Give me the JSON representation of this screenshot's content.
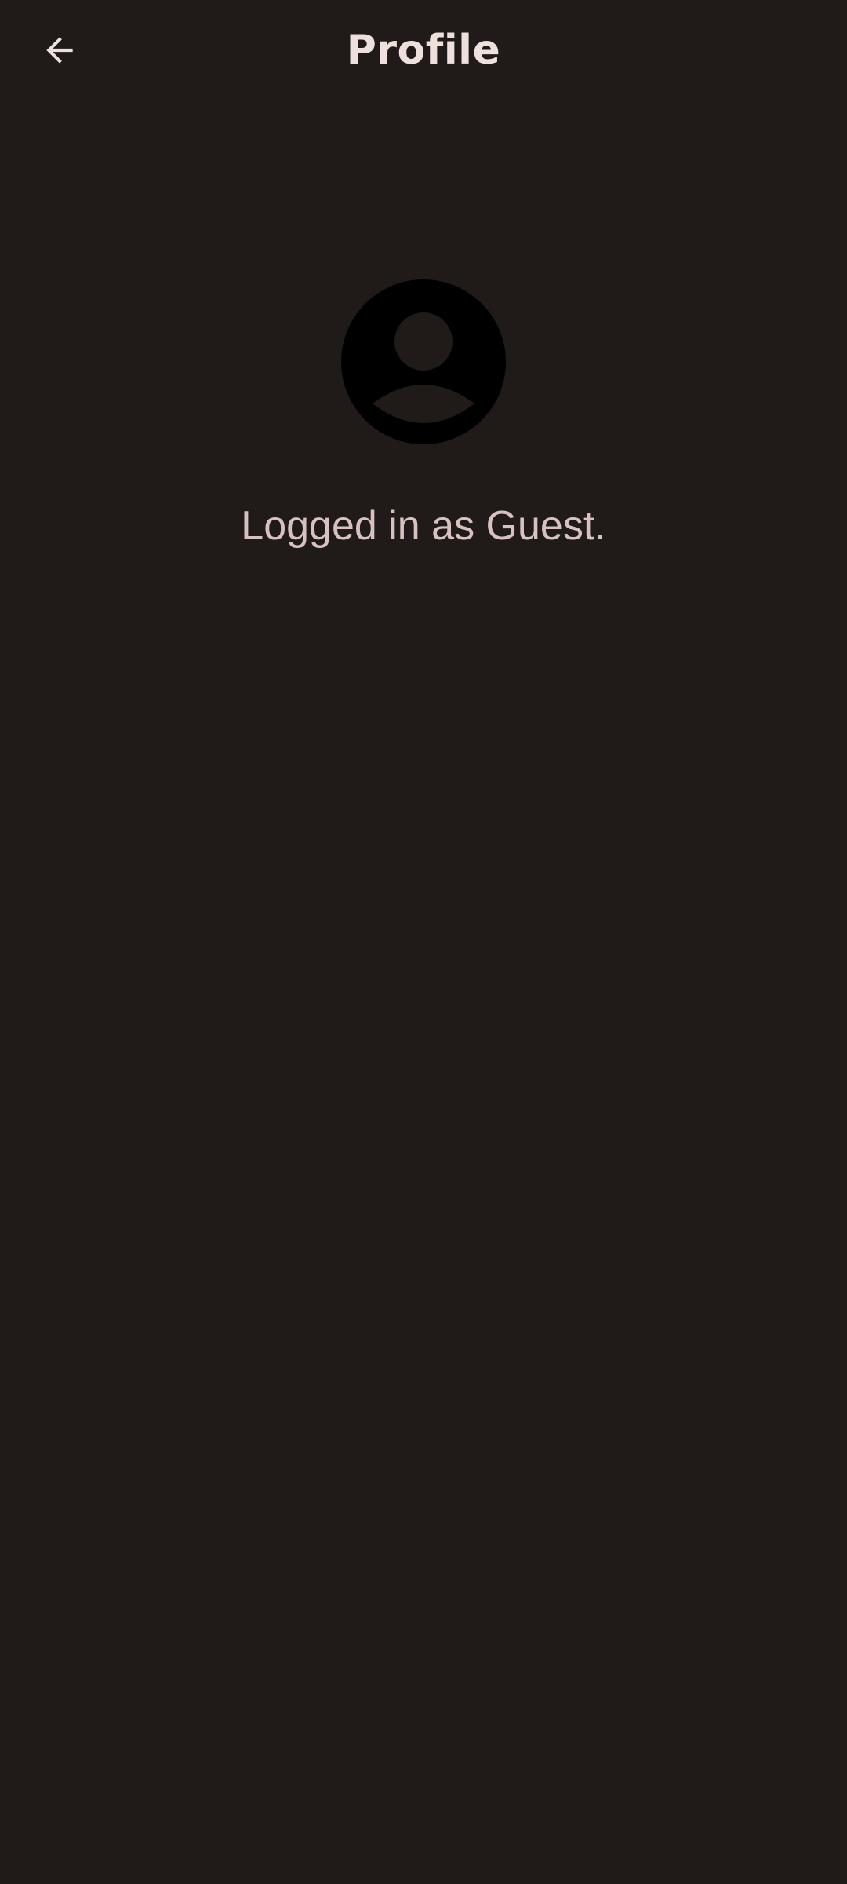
{
  "header": {
    "back_icon": "arrow-back-icon",
    "title": "Profile"
  },
  "profile": {
    "avatar_icon": "account-circle-icon",
    "status_text": "Logged in as Guest."
  },
  "colors": {
    "background": "#201a19",
    "title": "#ede0dd",
    "body_text": "#d8c2bf",
    "avatar": "#000000"
  }
}
